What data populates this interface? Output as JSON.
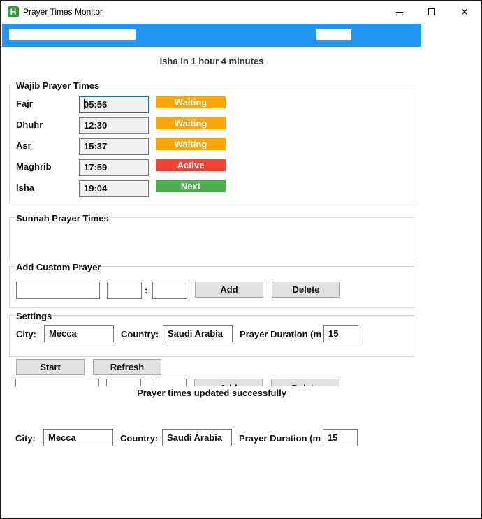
{
  "window": {
    "title": "Prayer Times Monitor",
    "app_icon_letter": "H",
    "minimize_glyph": "",
    "maximize_glyph": "",
    "close_glyph": "✕"
  },
  "next_prayer_text": "Isha in 1 hour 4 minutes",
  "wajib": {
    "label": "Wajib Prayer Times",
    "prayers": [
      {
        "name": "Fajr",
        "time": "05:56",
        "status": "Waiting",
        "status_color": "#ffa500"
      },
      {
        "name": "Dhuhr",
        "time": "12:30",
        "status": "Waiting",
        "status_color": "#ffa500"
      },
      {
        "name": "Asr",
        "time": "15:37",
        "status": "Waiting",
        "status_color": "#ffa500"
      },
      {
        "name": "Maghrib",
        "time": "17:59",
        "status": "Active",
        "status_color": "#f44336"
      },
      {
        "name": "Isha",
        "time": "19:04",
        "status": "Next",
        "status_color": "#4caf50"
      }
    ]
  },
  "sunnah": {
    "label": "Sunnah Prayer Times"
  },
  "custom": {
    "label": "Add Custom Prayer",
    "name_value": "",
    "hour_value": "",
    "colon": ":",
    "minute_value": "",
    "add_label": "Add",
    "delete_label": "Delete"
  },
  "settings": {
    "label": "Settings",
    "city_label": "City:",
    "city_value": "Mecca",
    "country_label": "Country:",
    "country_value": "Saudi Arabia",
    "duration_label": "Prayer Duration (m",
    "duration_value": "15"
  },
  "actions": {
    "start_label": "Start",
    "refresh_label": "Refresh"
  },
  "status_message": "Prayer times updated successfully",
  "settings_duplicate": {
    "city_label": "City:",
    "city_value": "Mecca",
    "country_label": "Country:",
    "country_value": "Saudi Arabia",
    "duration_label": "Prayer Duration (m",
    "duration_value": "15"
  },
  "colors": {
    "banner": "#2196f3",
    "waiting": "#ffa500",
    "active": "#f44336",
    "next": "#4caf50"
  }
}
